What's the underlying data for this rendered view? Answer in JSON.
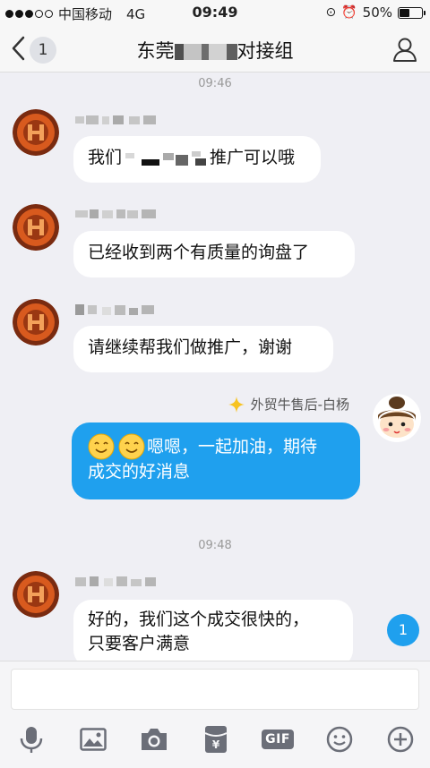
{
  "status_bar": {
    "carrier": "中国移动",
    "network": "4G",
    "time": "09:49",
    "battery": "50%",
    "battery_level": 0.5
  },
  "nav": {
    "back_count": "1",
    "title_prefix": "东莞",
    "title_suffix": "对接组"
  },
  "messages": {
    "time1": "09:46",
    "msg1_a": "我们",
    "msg1_b": "推广可以哦",
    "msg2": "已经收到两个有质量的询盘了",
    "msg3": "请继续帮我们做推广，谢谢",
    "my_name": "外贸牛售后-白杨",
    "my_msg_line1": "嗯嗯，一起加油，期待",
    "my_msg_line2": "成交的好消息",
    "time2": "09:48",
    "msg4_line1": "好的，我们这个成交很快的，",
    "msg4_line2": "只要客户满意"
  },
  "new_message_badge": "1",
  "input": {
    "value": "",
    "placeholder": ""
  },
  "toolbar": {
    "gif_label": "GIF"
  },
  "colors": {
    "accent": "#1fa0ee",
    "background": "#efeff4"
  },
  "icons": [
    "back-icon",
    "group-icon",
    "star-icon",
    "mic-icon",
    "image-icon",
    "camera-icon",
    "red-packet-icon",
    "gif-icon",
    "emoji-icon",
    "plus-icon"
  ]
}
